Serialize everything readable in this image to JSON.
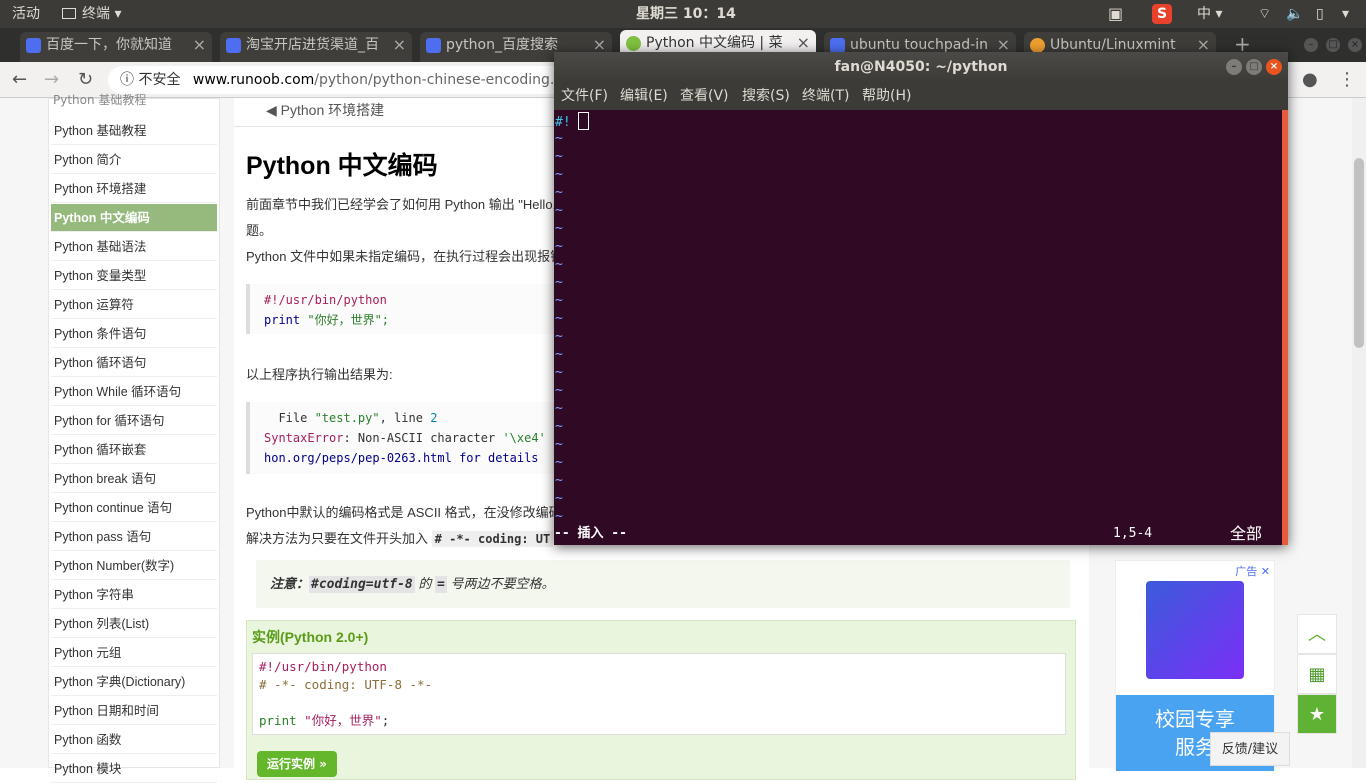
{
  "panel": {
    "activities": "活动",
    "app_menu": "终端",
    "clock": "星期三 10：14",
    "input_method": "中"
  },
  "tabs": [
    {
      "label": "百度一下，你就知道"
    },
    {
      "label": "淘宝开店进货渠道_百"
    },
    {
      "label": "python_百度搜索"
    },
    {
      "label": "Python 中文编码 | 菜"
    },
    {
      "label": "ubuntu touchpad-in"
    },
    {
      "label": "Ubuntu/Linuxmint"
    }
  ],
  "navbar": {
    "security": "不安全",
    "url_domain": "www.runoob.com",
    "url_path": "/python/python-chinese-encoding.htm"
  },
  "sidebar": {
    "header": "Python 基础教程",
    "items": [
      "Python 基础教程",
      "Python 简介",
      "Python 环境搭建",
      "Python 中文编码",
      "Python 基础语法",
      "Python 变量类型",
      "Python 运算符",
      "Python 条件语句",
      "Python 循环语句",
      "Python While 循环语句",
      "Python for 循环语句",
      "Python 循环嵌套",
      "Python break 语句",
      "Python continue 语句",
      "Python pass 语句",
      "Python Number(数字)",
      "Python 字符串",
      "Python 列表(List)",
      "Python 元组",
      "Python 字典(Dictionary)",
      "Python 日期和时间",
      "Python 函数",
      "Python 模块"
    ],
    "active_index": 3
  },
  "main": {
    "prev_link": "Python 环境搭建",
    "title": "Python 中文编码",
    "para1": "前面章节中我们已经学会了如何用 Python 输出 \"Hello,",
    "para1b": "题。",
    "para2": "Python 文件中如果未指定编码，在执行过程会出现报错",
    "code1_line1": "#!/usr/bin/python",
    "code1_kw": "print",
    "code1_str": "\"你好，世界\";",
    "output_label": "以上程序执行输出结果为:",
    "code2_line1_a": "  File ",
    "code2_line1_b": "\"test.py\"",
    "code2_line1_c": ", line ",
    "code2_line1_d": "2",
    "code2_line2_a": "SyntaxError",
    "code2_line2_b": ": Non-",
    "code2_line2_c": "ASCII character ",
    "code2_line2_d": "'\\xe4'",
    "code2_line3": "hon.org/peps/pep-0263.html for details",
    "para3": "Python中默认的编码格式是 ASCII 格式，在没修改编码",
    "para4": "解决方法为只要在文件开头加入",
    "para4_code": "# -*- coding: UT",
    "note_label": "注意：",
    "note_code": "#coding=utf-8",
    "note_mid": "的",
    "note_eq": "=",
    "note_end": "号两边不要空格。",
    "example_title": "实例(Python 2.0+)",
    "ex_line1": "#!/usr/bin/python",
    "ex_line2": "# -*- coding: UTF-8 -*-",
    "ex_kw": "print",
    "ex_str": "\"你好，世界\"",
    "ex_semicolon": ";",
    "run_button": "运行实例 »"
  },
  "ad": {
    "ad_label": "广告",
    "campus_text": "校园专享",
    "campus_text2": "服务"
  },
  "feedback": "反馈/建议",
  "terminal": {
    "title": "fan@N4050: ~/python",
    "menu": [
      "文件(F)",
      "编辑(E)",
      "查看(V)",
      "搜索(S)",
      "终端(T)",
      "帮助(H)"
    ],
    "first_line": "#!",
    "tilde_count": 22,
    "mode": "-- 插入 --",
    "position": "1,5-4",
    "scroll_pos": "全部"
  },
  "colors": {
    "terminal_bg": "#300a24",
    "sidebar_active": "#96b97d",
    "accent_green": "#5fb233"
  }
}
